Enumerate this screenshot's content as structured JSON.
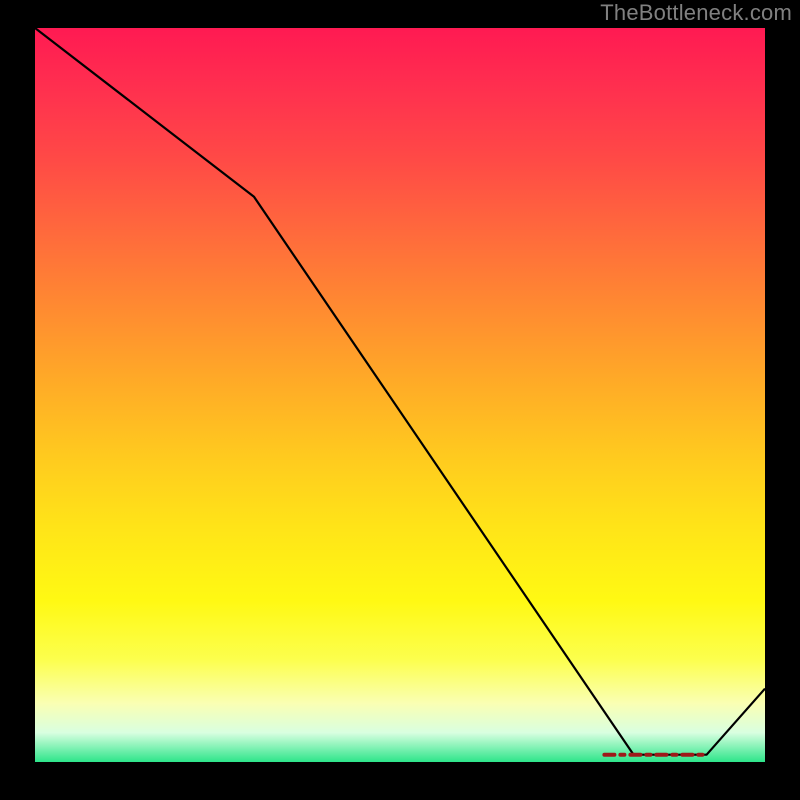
{
  "watermark": "TheBottleneck.com",
  "chart_data": {
    "type": "line",
    "title": "",
    "xlabel": "",
    "ylabel": "",
    "xlim": [
      0,
      100
    ],
    "ylim": [
      0,
      100
    ],
    "x": [
      0,
      30,
      82,
      92,
      100
    ],
    "values": [
      100,
      77,
      1,
      1,
      10
    ],
    "optimal_flat_segment": {
      "x_start": 78,
      "x_end": 92,
      "y": 1
    },
    "background_gradient_stops": [
      {
        "pct": 0,
        "color": "#ff1a52"
      },
      {
        "pct": 50,
        "color": "#ffc91f"
      },
      {
        "pct": 92,
        "color": "#fcff4d"
      },
      {
        "pct": 100,
        "color": "#2de58a"
      }
    ],
    "annotations": []
  }
}
